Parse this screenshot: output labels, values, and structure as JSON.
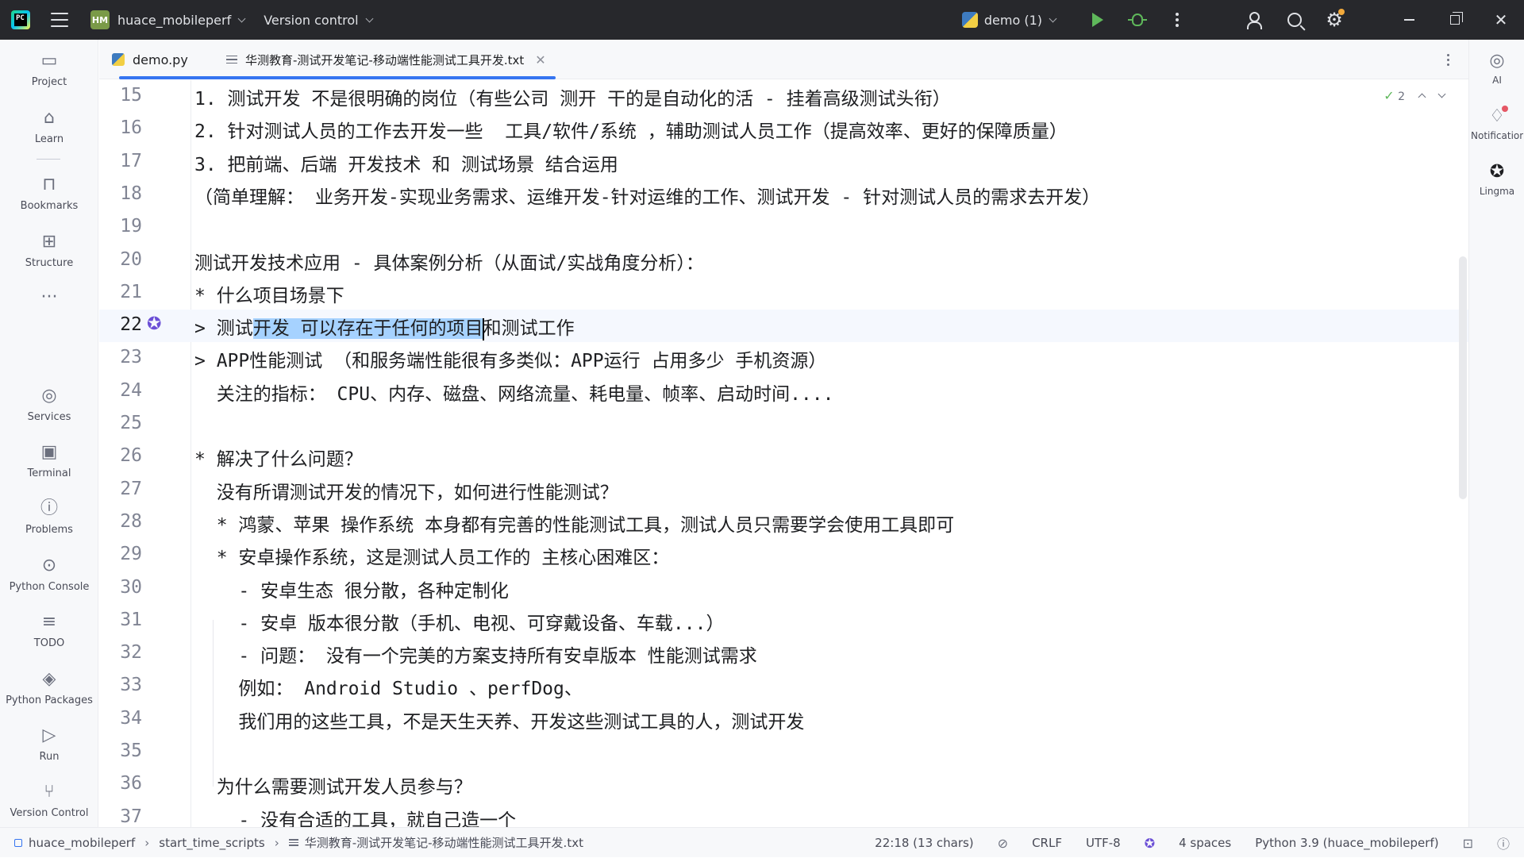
{
  "titlebar": {
    "logo_text": "PC",
    "project_badge": "HM",
    "project_name": "huace_mobileperf",
    "version_control": "Version control",
    "run_config": "demo (1)"
  },
  "left_strip": [
    {
      "name": "project",
      "label": "Project",
      "icon": "folder-icon",
      "glyph": "▭"
    },
    {
      "name": "learn",
      "label": "Learn",
      "icon": "graduation-cap-icon",
      "glyph": "⌂"
    },
    {
      "name": "bookmarks",
      "label": "Bookmarks",
      "icon": "bookmark-icon",
      "glyph": "⊓"
    },
    {
      "name": "structure",
      "label": "Structure",
      "icon": "structure-icon",
      "glyph": "⊞"
    },
    {
      "name": "more",
      "label": "",
      "icon": "more-icon",
      "glyph": "···"
    },
    {
      "name": "services",
      "label": "Services",
      "icon": "services-icon",
      "glyph": "◎"
    },
    {
      "name": "terminal",
      "label": "Terminal",
      "icon": "terminal-icon",
      "glyph": "▣"
    },
    {
      "name": "problems",
      "label": "Problems",
      "icon": "problems-icon",
      "glyph": "ⓘ"
    },
    {
      "name": "python-console",
      "label": "Python Console",
      "icon": "python-console-icon",
      "glyph": "⊙"
    },
    {
      "name": "todo",
      "label": "TODO",
      "icon": "todo-icon",
      "glyph": "≡"
    },
    {
      "name": "python-packages",
      "label": "Python Packages",
      "icon": "layers-icon",
      "glyph": "◈"
    },
    {
      "name": "run",
      "label": "Run",
      "icon": "run-icon",
      "glyph": "▷"
    },
    {
      "name": "version-control",
      "label": "Version Control",
      "icon": "git-icon",
      "glyph": "⑂"
    }
  ],
  "right_strip": [
    {
      "name": "ai",
      "label": "AI",
      "icon": "ai-icon",
      "glyph": "◎"
    },
    {
      "name": "notifications",
      "label": "Notifications",
      "icon": "bell-icon",
      "glyph": "♢"
    },
    {
      "name": "lingma",
      "label": "Lingma",
      "icon": "lingma-icon",
      "glyph": "✪"
    }
  ],
  "tabs": [
    {
      "label": "demo.py",
      "active": false
    },
    {
      "label": "华测教育-测试开发笔记-移动端性能测试工具开发.txt",
      "active": true
    }
  ],
  "editor": {
    "inspection_count": "2",
    "lines": [
      {
        "n": "15",
        "text": "1. 测试开发 不是很明确的岗位（有些公司 测开 干的是自动化的活 - 挂着高级测试头衔）"
      },
      {
        "n": "16",
        "text": "2. 针对测试人员的工作去开发一些  工具/软件/系统 ，辅助测试人员工作（提高效率、更好的保障质量）"
      },
      {
        "n": "17",
        "text": "3. 把前端、后端 开发技术 和 测试场景 结合运用"
      },
      {
        "n": "18",
        "text": "（简单理解： 业务开发-实现业务需求、运维开发-针对运维的工作、测试开发 - 针对测试人员的需求去开发）"
      },
      {
        "n": "19",
        "text": ""
      },
      {
        "n": "20",
        "text": "测试开发技术应用 - 具体案例分析（从面试/实战角度分析）："
      },
      {
        "n": "21",
        "text": "* 什么项目场景下"
      },
      {
        "n": "22",
        "pre": "> 测试",
        "selected": "开发 可以存在于任何的项目",
        "post": "和测试工作",
        "current": true
      },
      {
        "n": "23",
        "text": "> APP性能测试 （和服务端性能很有多类似：APP运行 占用多少 手机资源）"
      },
      {
        "n": "24",
        "text": "  关注的指标： CPU、内存、磁盘、网络流量、耗电量、帧率、启动时间...."
      },
      {
        "n": "25",
        "text": ""
      },
      {
        "n": "26",
        "text": "* 解决了什么问题？"
      },
      {
        "n": "27",
        "text": "  没有所谓测试开发的情况下，如何进行性能测试？"
      },
      {
        "n": "28",
        "text": "  * 鸿蒙、苹果 操作系统 本身都有完善的性能测试工具，测试人员只需要学会使用工具即可"
      },
      {
        "n": "29",
        "text": "  * 安卓操作系统，这是测试人员工作的 主核心困难区："
      },
      {
        "n": "30",
        "text": "    - 安卓生态 很分散，各种定制化"
      },
      {
        "n": "31",
        "text": "    - 安卓 版本很分散（手机、电视、可穿戴设备、车载...）"
      },
      {
        "n": "32",
        "text": "    - 问题： 没有一个完美的方案支持所有安卓版本 性能测试需求"
      },
      {
        "n": "33",
        "text": "    例如： Android Studio 、perfDog、"
      },
      {
        "n": "34",
        "text": "    我们用的这些工具，不是天生天养、开发这些测试工具的人，测试开发"
      },
      {
        "n": "35",
        "text": ""
      },
      {
        "n": "36",
        "text": "  为什么需要测试开发人员参与？"
      },
      {
        "n": "37",
        "text": "    - 没有合适的工具，就自己造一个"
      }
    ]
  },
  "statusbar": {
    "crumbs": [
      "huace_mobileperf",
      "start_time_scripts",
      "华测教育-测试开发笔记-移动端性能测试工具开发.txt"
    ],
    "position": "22:18 (13 chars)",
    "line_sep": "CRLF",
    "encoding": "UTF-8",
    "indent": "4 spaces",
    "interpreter": "Python 3.9 (huace_mobileperf)"
  },
  "colors": {
    "accent": "#3574f0",
    "selection": "#a6d2ff",
    "titlebar_bg": "#27282c",
    "run_green": "#5fb85b"
  }
}
